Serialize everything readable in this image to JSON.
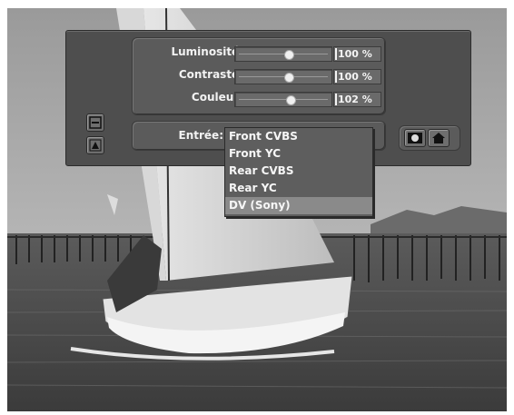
{
  "settings": {
    "rows": [
      {
        "label": "Luminosité:",
        "value_text": "100 %",
        "level_percent": 55
      },
      {
        "label": "Contraste:",
        "value_text": "100 %",
        "level_percent": 55
      },
      {
        "label": "Couleur:",
        "value_text": "102 %",
        "level_percent": 57
      }
    ]
  },
  "input_selector": {
    "label": "Entrée:",
    "options": [
      "Front CVBS",
      "Front YC",
      "Rear CVBS",
      "Rear YC",
      "DV (Sony)"
    ],
    "highlighted_index": 4
  },
  "icons": {
    "side_top": "window-minimize-icon",
    "side_bottom": "triangle-expand-icon",
    "right_1": "screen-view-icon",
    "right_2": "home-icon"
  },
  "colors": {
    "panel": "#4e4e4e",
    "highlight": "#8a8a8a",
    "text": "#f2f2f2"
  }
}
